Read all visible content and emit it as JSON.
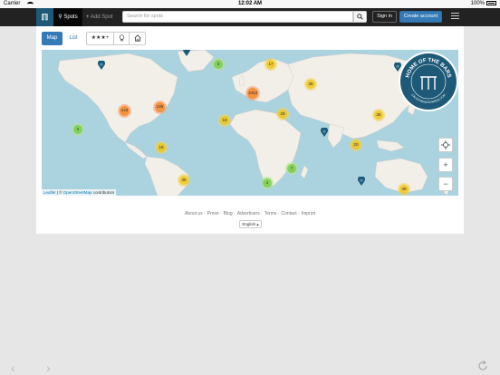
{
  "status_bar": {
    "carrier": "Carrier",
    "time": "12:02 AM",
    "battery": "100%"
  },
  "navbar": {
    "logo": "ℿ",
    "spots_label": "Spots",
    "add_spot_label": "Add Spot",
    "search_placeholder": "Search for spots",
    "sign_in_label": "Sign in",
    "create_account_label": "Create account"
  },
  "view_toggle": {
    "map_label": "Map",
    "list_label": "List"
  },
  "filters": {
    "rating_label": "★★★+"
  },
  "map": {
    "clusters": [
      {
        "label": "3",
        "color": "green"
      },
      {
        "label": "17",
        "color": "yellow"
      },
      {
        "label": "36",
        "color": "yellow"
      },
      {
        "label": "1053",
        "color": "orange"
      },
      {
        "label": "148",
        "color": "orange"
      },
      {
        "label": "143",
        "color": "orange"
      },
      {
        "label": "19",
        "color": "yellow"
      },
      {
        "label": "29",
        "color": "yellow"
      },
      {
        "label": "36",
        "color": "yellow"
      },
      {
        "label": "2",
        "color": "green"
      },
      {
        "label": "19",
        "color": "yellow"
      },
      {
        "label": "20",
        "color": "yellow"
      },
      {
        "label": "7",
        "color": "green"
      },
      {
        "label": "35",
        "color": "yellow"
      },
      {
        "label": "4",
        "color": "green"
      },
      {
        "label": "49",
        "color": "yellow"
      }
    ],
    "badge_text": "HOME OF THE BARS",
    "badge_url": "CALISTHENICS-PARKS.COM",
    "zoom_in": "+",
    "zoom_out": "−",
    "attribution_leaflet": "Leaflet",
    "attribution_sep": " | © ",
    "attribution_osm": "OpenStreetMap",
    "attribution_contrib": " contributors"
  },
  "footer": {
    "links": [
      "About us",
      "Press",
      "Blog",
      "Advertisers",
      "Terms",
      "Contact",
      "Imprint"
    ],
    "language": "English ▴"
  },
  "colors": {
    "nav_bg": "#222222",
    "brand_blue": "#1e5a78",
    "primary": "#337ab7",
    "water": "#aad3df",
    "land": "#f2efe9"
  }
}
